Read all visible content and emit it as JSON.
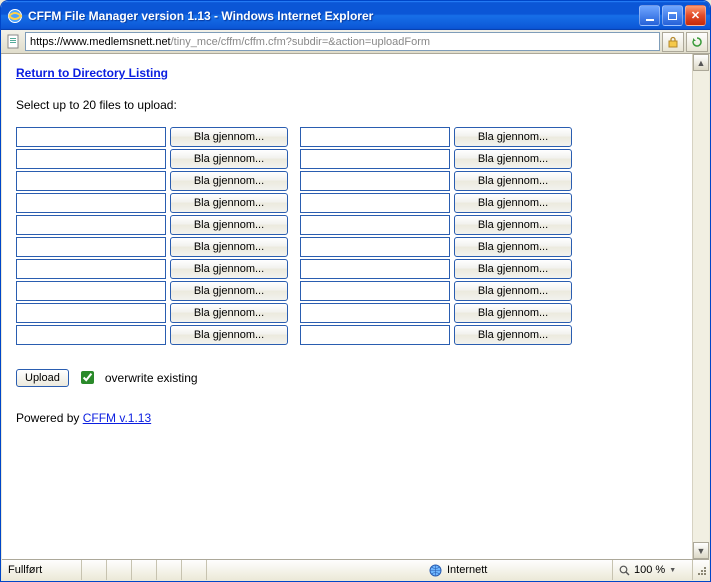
{
  "window": {
    "title": "CFFM File Manager version 1.13 - Windows Internet Explorer"
  },
  "address": {
    "https_part": "https://www.medlemsnett.net",
    "rest_part": "/tiny_mce/cffm/cffm.cfm?subdir=&action=uploadForm"
  },
  "page": {
    "return_link": "Return to Directory Listing",
    "instruction": "Select up to 20 files to upload:",
    "browse_label": "Bla gjennom...",
    "rows": 10,
    "upload_label": "Upload",
    "overwrite_label": "overwrite existing",
    "overwrite_checked": true,
    "powered_prefix": "Powered by ",
    "powered_link": "CFFM v.1.13"
  },
  "status": {
    "state": "Fullført",
    "zone": "Internett",
    "zoom": "100 %"
  }
}
